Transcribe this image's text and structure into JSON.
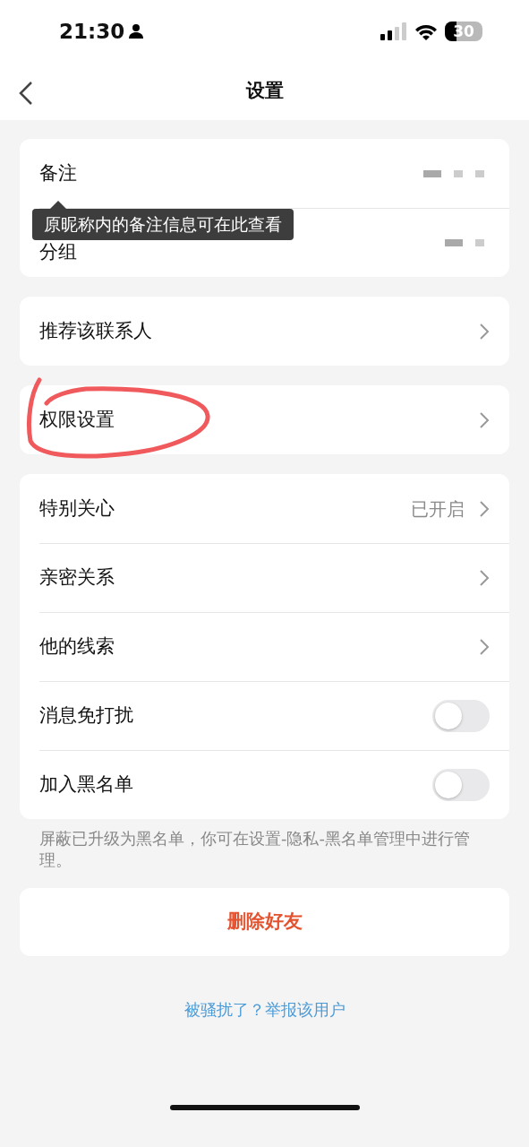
{
  "status_bar": {
    "time": "21:30",
    "battery": "30"
  },
  "nav": {
    "title": "设置"
  },
  "groups": [
    {
      "items": [
        {
          "kind": "redacted",
          "label": "备注"
        },
        {
          "kind": "redacted",
          "label": "分组"
        }
      ]
    },
    {
      "items": [
        {
          "kind": "link",
          "label": "推荐该联系人"
        }
      ]
    },
    {
      "annotated": true,
      "items": [
        {
          "kind": "link",
          "label": "权限设置"
        }
      ]
    },
    {
      "items": [
        {
          "kind": "link",
          "label": "特别关心",
          "value": "已开启"
        },
        {
          "kind": "link",
          "label": "亲密关系"
        },
        {
          "kind": "link",
          "label": "他的线索"
        },
        {
          "kind": "toggle",
          "label": "消息免打扰",
          "on": false
        },
        {
          "kind": "toggle",
          "label": "加入黑名单",
          "on": false
        }
      ]
    }
  ],
  "tooltip": {
    "text": "原昵称内的备注信息可在此查看"
  },
  "note": "屏蔽已升级为黑名单，你可在设置-隐私-黑名单管理中进行管理。",
  "delete_button": "删除好友",
  "report_link": "被骚扰了？举报该用户"
}
